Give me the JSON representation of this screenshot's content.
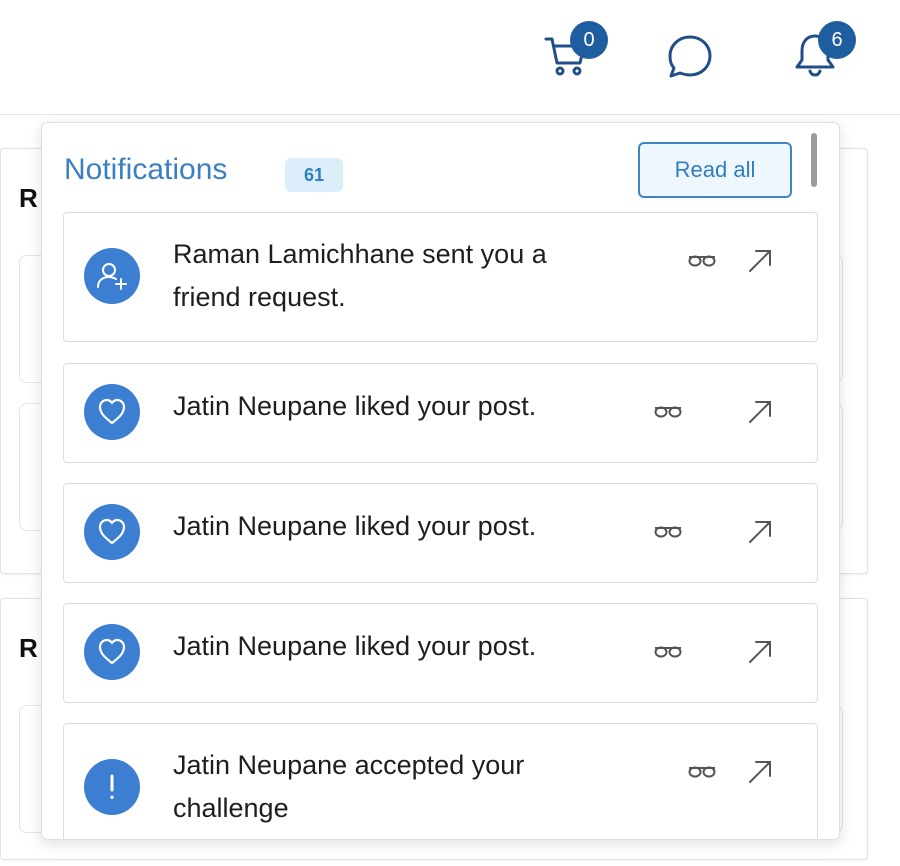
{
  "header": {
    "cart_count": "0",
    "bell_count": "6",
    "icons": [
      "cart-icon",
      "chat-icon",
      "bell-icon"
    ]
  },
  "background": {
    "heading1": "R",
    "heading2": "R"
  },
  "notifications": {
    "title": "Notifications",
    "count": "61",
    "read_all_label": "Read all",
    "items": [
      {
        "icon": "add-user-icon",
        "line1": "Raman Lamichhane sent you a",
        "line2": "friend request."
      },
      {
        "icon": "heart-icon",
        "line1": "Jatin Neupane liked your post."
      },
      {
        "icon": "heart-icon",
        "line1": "Jatin Neupane liked your post."
      },
      {
        "icon": "heart-icon",
        "line1": "Jatin Neupane liked your post."
      },
      {
        "icon": "exclamation-icon",
        "line1": "Jatin Neupane accepted your",
        "line2": "challenge"
      }
    ]
  },
  "colors": {
    "accent": "#3a7fc6",
    "badge": "#1f5e9e",
    "avatar": "#3c7ed2"
  }
}
